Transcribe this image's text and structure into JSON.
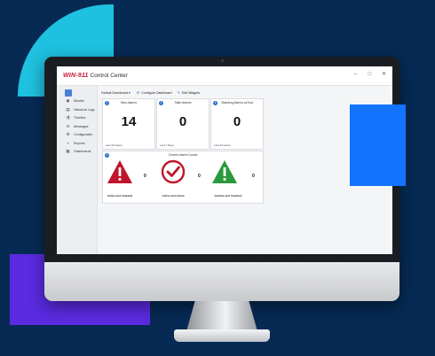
{
  "app": {
    "brand": "WIN-911",
    "title": "Control Center",
    "window_controls": [
      "–",
      "□",
      "✕"
    ]
  },
  "sidebar": {
    "items": [
      {
        "label": "Monitor",
        "icon": "monitor-icon"
      },
      {
        "label": "Historical Logs",
        "icon": "log-icon"
      },
      {
        "label": "Timeline",
        "icon": "timeline-icon"
      },
      {
        "label": "Messages",
        "icon": "message-icon"
      },
      {
        "label": "Configuration",
        "icon": "gear-icon"
      },
      {
        "label": "Reports",
        "icon": "report-icon"
      },
      {
        "label": "Dashboards",
        "icon": "dashboard-icon"
      }
    ]
  },
  "toolbar": {
    "dashboard_select": "Default Dashboard",
    "configure_label": "Configure Dashboard",
    "edit_label": "Edit Widgets"
  },
  "cards": [
    {
      "title": "New Alarms",
      "value": "14",
      "footer": "Last 24 Hours"
    },
    {
      "title": "Stale Alarms",
      "value": "0",
      "footer": "Last 7 Days"
    },
    {
      "title": "Standing Alarms at End",
      "value": "0",
      "footer": "Last 24 Hours"
    }
  ],
  "alarm_counts": {
    "title": "Current Alarm Counts",
    "items": [
      {
        "label": "Active and Unacked",
        "value": "0",
        "color": "#c0152b",
        "icon": "warning-icon"
      },
      {
        "label": "Active and Acked",
        "value": "0",
        "color": "#c0152b",
        "icon": "checkmark-icon"
      },
      {
        "label": "Inactive and Unacked",
        "value": "0",
        "color": "#2a9a3c",
        "icon": "warning-icon"
      }
    ]
  },
  "colors": {
    "accent": "#2f6fd0",
    "alarm_red": "#c0152b",
    "ok_green": "#2a9a3c",
    "brand_red": "#c8102e"
  }
}
